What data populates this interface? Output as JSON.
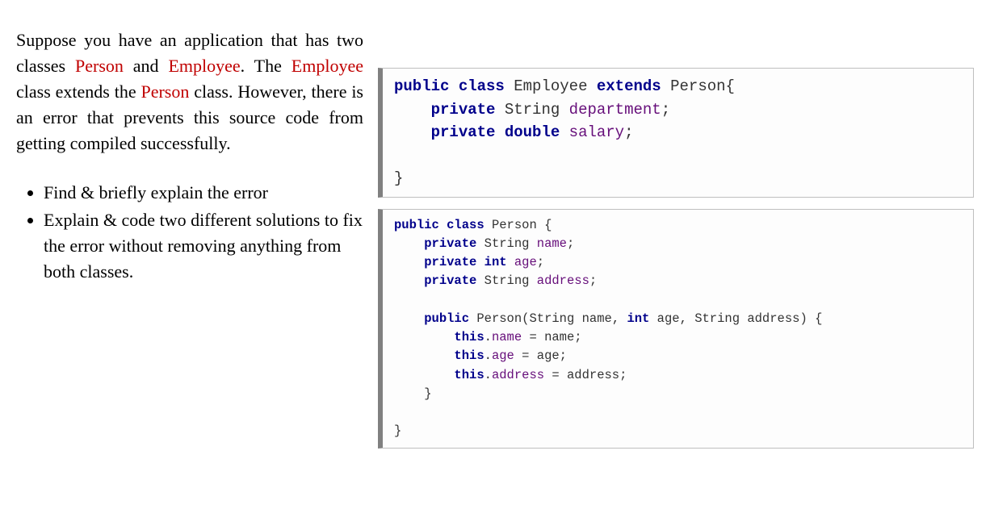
{
  "intro": {
    "t1": "Suppose you have an application that has two classes ",
    "person": "Person",
    "t2": " and ",
    "employee": "Employee",
    "t3": ". The ",
    "t4": " class extends the ",
    "t5": " class. However, there is an error that prevents this source code from getting compiled successfully."
  },
  "bullets": {
    "b1": "Find & briefly explain the error",
    "b2": "Explain & code two different solutions to fix the error without removing anything from both classes."
  },
  "code1": {
    "kw_public": "public",
    "kw_class": "class",
    "cls_employee": "Employee",
    "kw_extends": "extends",
    "cls_person": "Person",
    "brace_open": "{",
    "kw_private1": "private",
    "type_string1": "String",
    "fld_dept": "department",
    "semi": ";",
    "kw_private2": "private",
    "type_double": "double",
    "fld_salary": "salary",
    "brace_close": "}"
  },
  "code2": {
    "kw_public": "public",
    "kw_class": "class",
    "cls_person": "Person",
    "brace_open": "{",
    "kw_private": "private",
    "type_string": "String",
    "type_int": "int",
    "fld_name": "name",
    "fld_age": "age",
    "fld_address": "address",
    "semi": ";",
    "ctor_person": "Person",
    "paren_open": "(",
    "paren_close": ")",
    "comma": ",",
    "sp": " ",
    "arg_name": "name",
    "arg_age": "age",
    "arg_address": "address",
    "kw_this": "this",
    "dot": ".",
    "eq": " = ",
    "brace_close": "}"
  }
}
